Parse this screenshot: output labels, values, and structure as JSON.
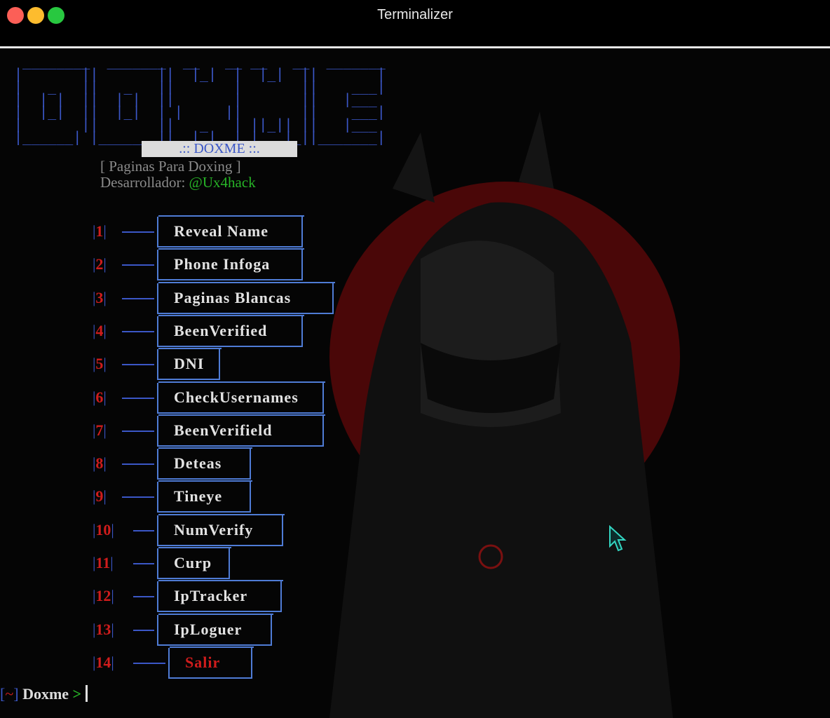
{
  "window": {
    "title": "Terminalizer"
  },
  "banner": {
    "ascii_lines": [
      " ________  _______  __   __ __   __  _______ ",
      "|       ||       ||  |_|  |  |_|  ||       |",
      "|   _   ||   _   ||       |       ||    ___|",
      "|  | |  ||  | |  ||       |       ||   |___ ",
      "|  |_|  ||  |_|  | |     ||       ||    ___|",
      "|       ||       ||   _   | ||_|| ||   |___ ",
      "|______| |_______||__| |__|_|   |_||_______|"
    ],
    "tag": ".:: DOXME ::.",
    "subtitle": "[ Paginas Para Doxing ]",
    "developer_label": "Desarrollador:",
    "developer_handle": "@Ux4hack"
  },
  "menu": [
    {
      "num": "1",
      "label": "Reveal Name"
    },
    {
      "num": "2",
      "label": "Phone Infoga"
    },
    {
      "num": "3",
      "label": "Paginas Blancas"
    },
    {
      "num": "4",
      "label": "BeenVerified"
    },
    {
      "num": "5",
      "label": "DNI"
    },
    {
      "num": "6",
      "label": "CheckUsernames"
    },
    {
      "num": "7",
      "label": "BeenVerifield"
    },
    {
      "num": "8",
      "label": "Deteas"
    },
    {
      "num": "9",
      "label": "Tineye"
    },
    {
      "num": "10",
      "label": "NumVerify"
    },
    {
      "num": "11",
      "label": "Curp"
    },
    {
      "num": "12",
      "label": "IpTracker"
    },
    {
      "num": "13",
      "label": "IpLoguer"
    },
    {
      "num": "14",
      "label": "Salir"
    }
  ],
  "prompt": {
    "open": "[",
    "tilde": "~",
    "close": "]",
    "name": "Doxme",
    "arrow": ">"
  },
  "colors": {
    "accent_blue": "#3b57c7",
    "number_red": "#d01c1c",
    "handle_green": "#27b327"
  }
}
